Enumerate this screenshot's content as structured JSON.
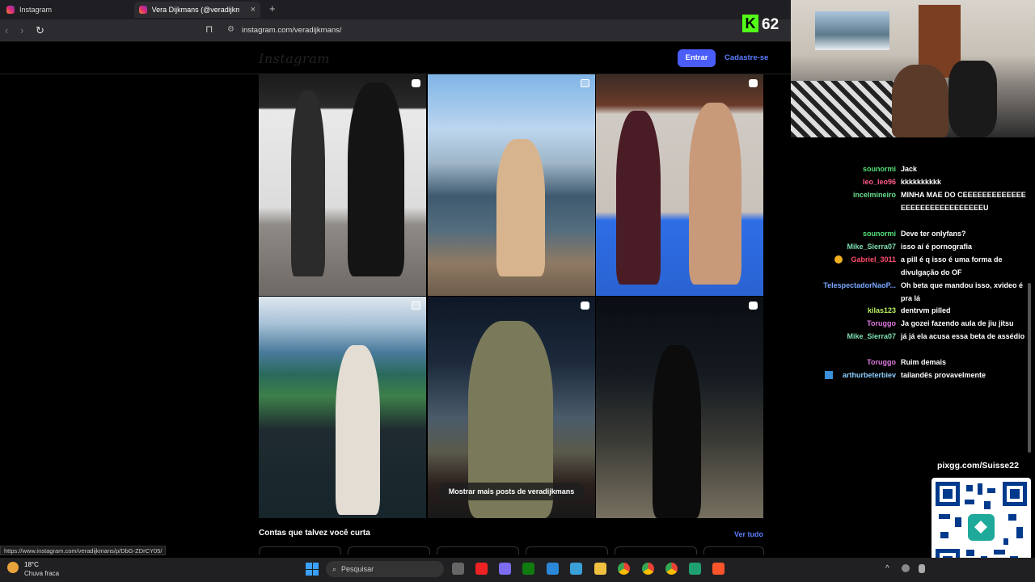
{
  "browser": {
    "tabs": [
      {
        "label": "Instagram"
      },
      {
        "label": "Vera Dijkmans (@veradijkmans)"
      }
    ],
    "new_tab_label": "+",
    "close_label": "×",
    "url": "instagram.com/veradijkmans/",
    "status_url": "https://www.instagram.com/veradijkmans/p/DbG-ZDrCY05/"
  },
  "stream": {
    "logo_letter": "K",
    "viewer_count": "62"
  },
  "instagram": {
    "logo": "Instagram",
    "login_label": "Entrar",
    "signup_label": "Cadastre-se",
    "more_posts_label": "Mostrar mais posts de veradijkmans",
    "suggestions_title": "Contas que talvez você curta",
    "see_all_label": "Ver tudo"
  },
  "chat": [
    {
      "user": "sounormi",
      "color": "#55e07a",
      "msg": "Jack"
    },
    {
      "user": "leo_leo96",
      "color": "#ff5a8a",
      "msg": "kkkkkkkkkk"
    },
    {
      "user": "incelmineiro",
      "color": "#66e08f",
      "msg": "MINHA MAE DO CEEEEEEEEEEEEEEEEEEEEEEEEEEEEEEU"
    },
    {
      "user": "sounormi",
      "color": "#55e07a",
      "msg": "Deve ter onlyfans?"
    },
    {
      "user": "Mike_Sierra07",
      "color": "#7de0b0",
      "msg": "isso aí é pornografia"
    },
    {
      "user": "Gabriel_3011",
      "color": "#ff4a6e",
      "msg": "a pill é q isso é uma forma de divulgação do OF"
    },
    {
      "user": "TelespectadorNaoP...",
      "color": "#7aa8ff",
      "msg": "Oh beta que mandou isso, xvideo é pra lá"
    },
    {
      "user": "kilas123",
      "color": "#b8f060",
      "msg": "dentrvm pilled"
    },
    {
      "user": "Toruggo",
      "color": "#e07ae0",
      "msg": "Ja gozei fazendo aula de jiu jitsu"
    },
    {
      "user": "Mike_Sierra07",
      "color": "#7de0b0",
      "msg": "já já ela acusa essa beta de assédio"
    },
    {
      "user": "Toruggo",
      "color": "#e07ae0",
      "msg": "Ruim demais"
    },
    {
      "user": "arthurbeterbiev",
      "color": "#8fd0ff",
      "msg": "tailandês provavelmente"
    }
  ],
  "pix": {
    "label": "pixgg.com/Suisse22"
  },
  "taskbar": {
    "temp": "18°C",
    "weather": "Chuva fraca",
    "search_placeholder": "Pesquisar"
  }
}
